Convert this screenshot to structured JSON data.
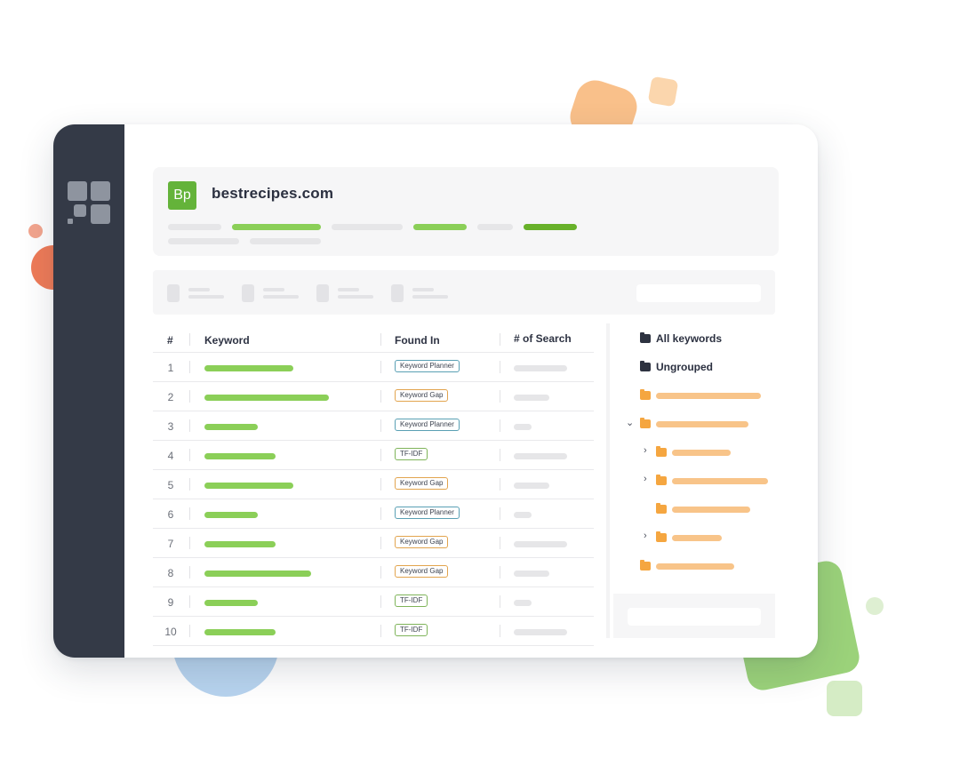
{
  "site": {
    "initials": "Bp",
    "name": "bestrecipes.com"
  },
  "colors": {
    "brand_green": "#64b33a",
    "bar_green": "#8bcf58",
    "folder_orange": "#f5a640",
    "sidebar_dark": "#343a47"
  },
  "table": {
    "columns": [
      "#",
      "Keyword",
      "Found In",
      "# of Search"
    ],
    "rows": [
      {
        "num": "1",
        "found_in": "Keyword Planner"
      },
      {
        "num": "2",
        "found_in": "Keyword Gap"
      },
      {
        "num": "3",
        "found_in": "Keyword Planner"
      },
      {
        "num": "4",
        "found_in": "TF-IDF"
      },
      {
        "num": "5",
        "found_in": "Keyword Gap"
      },
      {
        "num": "6",
        "found_in": "Keyword Planner"
      },
      {
        "num": "7",
        "found_in": "Keyword Gap"
      },
      {
        "num": "8",
        "found_in": "Keyword Gap"
      },
      {
        "num": "9",
        "found_in": "TF-IDF"
      },
      {
        "num": "10",
        "found_in": "TF-IDF"
      }
    ]
  },
  "folders": {
    "all_keywords": "All keywords",
    "ungrouped": "Ungrouped",
    "icon": "folder-icon",
    "chevron_icon": "chevron-icon"
  }
}
